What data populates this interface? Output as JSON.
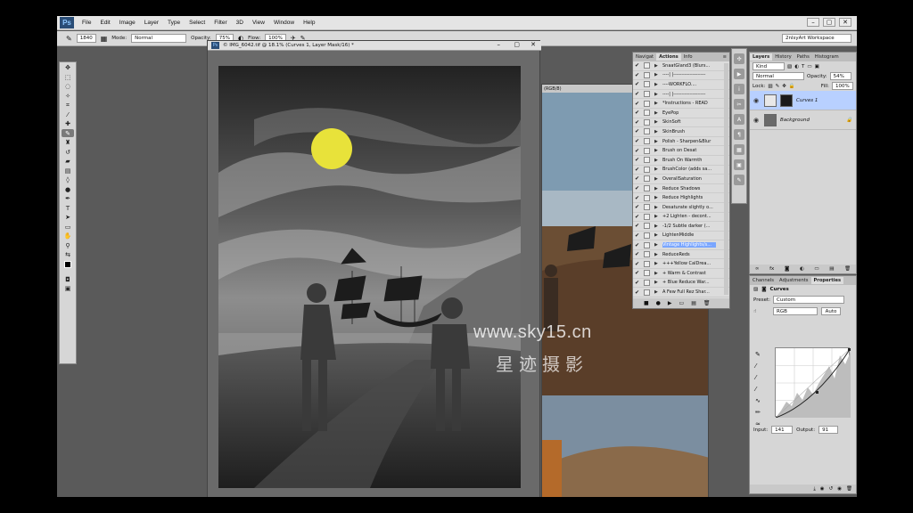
{
  "menu": [
    "File",
    "Edit",
    "Image",
    "Layer",
    "Type",
    "Select",
    "Filter",
    "3D",
    "View",
    "Window",
    "Help"
  ],
  "logo": "Ps",
  "options": {
    "brush_size": "1840",
    "mode_label": "Mode:",
    "mode_value": "Normal",
    "opacity_label": "Opacity:",
    "opacity_value": "75%",
    "flow_label": "Flow:",
    "flow_value": "100%",
    "workspace": "2nlsyArt Workspace"
  },
  "document": {
    "title": "© IMG_6042.tif @ 18.1% (Curves 1, Layer Mask/16) *",
    "bg_title": "(RGB/8)"
  },
  "actions_panel": {
    "tabs": [
      "Navigat",
      "Actions",
      "Info"
    ],
    "items": [
      {
        "label": "SnaatGland3 (Blurs...",
        "checked": true
      },
      {
        "label": "----| |--------------------",
        "checked": true
      },
      {
        "label": "----WORKFLO....",
        "checked": true
      },
      {
        "label": "----| |--------------------",
        "checked": true
      },
      {
        "label": "*Instructions - READ",
        "checked": true
      },
      {
        "label": "EyePop",
        "checked": true
      },
      {
        "label": "SkinSoft",
        "checked": true
      },
      {
        "label": "SkinBrush",
        "checked": true
      },
      {
        "label": "Polish - Sharpen&Blur",
        "checked": true
      },
      {
        "label": "Brush on Desat",
        "checked": true
      },
      {
        "label": "Brush On Warmth",
        "checked": true
      },
      {
        "label": "BrushColor (adds sa...",
        "checked": true
      },
      {
        "label": "OverallSaturation",
        "checked": true
      },
      {
        "label": "Reduce Shadows",
        "checked": true
      },
      {
        "label": "Reduce Highlights",
        "checked": true
      },
      {
        "label": "Desaturate slightly o...",
        "checked": true
      },
      {
        "label": "+2 Lighten - decont...",
        "checked": true
      },
      {
        "label": "-1/2 Subtle darker (...",
        "checked": true
      },
      {
        "label": "LightenMiddle",
        "checked": true
      },
      {
        "label": "Vintage Highlights/s...",
        "checked": true,
        "highlight": true
      },
      {
        "label": "ReduceReds",
        "checked": true
      },
      {
        "label": "+++Yellow CalDrea...",
        "checked": true
      },
      {
        "label": "+ Warm & Contrast",
        "checked": true
      },
      {
        "label": "+ Blue Reduce War...",
        "checked": true
      },
      {
        "label": "A Few Full Rez Shar...",
        "checked": true
      }
    ]
  },
  "layers_panel": {
    "tabs": [
      "Layers",
      "History",
      "Paths",
      "Histogram"
    ],
    "kind_label": "Kind",
    "blend_mode": "Normal",
    "opacity_label": "Opacity:",
    "opacity_value": "54%",
    "lock_label": "Lock:",
    "fill_label": "Fill:",
    "fill_value": "100%",
    "layers": [
      {
        "name": "Curves 1",
        "selected": true
      },
      {
        "name": "Background",
        "selected": false
      }
    ]
  },
  "properties_panel": {
    "tabs": [
      "Channels",
      "Adjustments",
      "Properties"
    ],
    "title": "Curves",
    "preset_label": "Preset:",
    "preset_value": "Custom",
    "channel_value": "RGB",
    "auto_label": "Auto",
    "input_label": "Input:",
    "input_value": "141",
    "output_label": "Output:",
    "output_value": "91"
  },
  "watermark": {
    "url": "www.sky15.cn",
    "cn": "星迹摄影"
  },
  "colors": {
    "accent_highlight": "#7aa6ff",
    "sun": "#e8e23a"
  }
}
